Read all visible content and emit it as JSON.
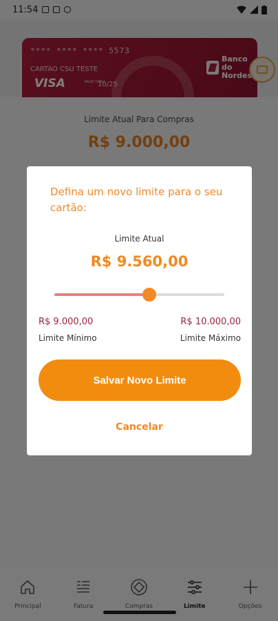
{
  "status_bar": {
    "time": "11:54"
  },
  "card": {
    "number": "**** **** **** 5573",
    "holder": "CARTAO CSU TESTE",
    "brand": "VISA",
    "valid_label": "VALID THRU",
    "expiry": "10/25",
    "bank_name_line1": "Banco do",
    "bank_name_line2": "Nordeste"
  },
  "background": {
    "current_limit_label": "Limite Atual Para Compras",
    "current_limit_value": "R$ 9.000,00"
  },
  "dialog": {
    "title": "Defina um novo limite para o seu cartão:",
    "limit_label": "Limite Atual",
    "limit_value": "R$ 9.560,00",
    "slider": {
      "min": 9000,
      "max": 10000,
      "value": 9560
    },
    "min_value": "R$ 9.000,00",
    "min_label": "Limite Mínimo",
    "max_value": "R$ 10.000,00",
    "max_label": "Limite Máximo",
    "save_label": "Salvar Novo Limite",
    "cancel_label": "Cancelar"
  },
  "nav": {
    "items": [
      {
        "label": "Principal",
        "icon": "home-icon"
      },
      {
        "label": "Fatura",
        "icon": "invoice-icon"
      },
      {
        "label": "Compras",
        "icon": "purchases-icon"
      },
      {
        "label": "Limite",
        "icon": "sliders-icon"
      },
      {
        "label": "Opções",
        "icon": "plus-icon"
      }
    ]
  },
  "colors": {
    "accent": "#f08a24",
    "brand": "#a01733",
    "range_value": "#9b2240"
  }
}
